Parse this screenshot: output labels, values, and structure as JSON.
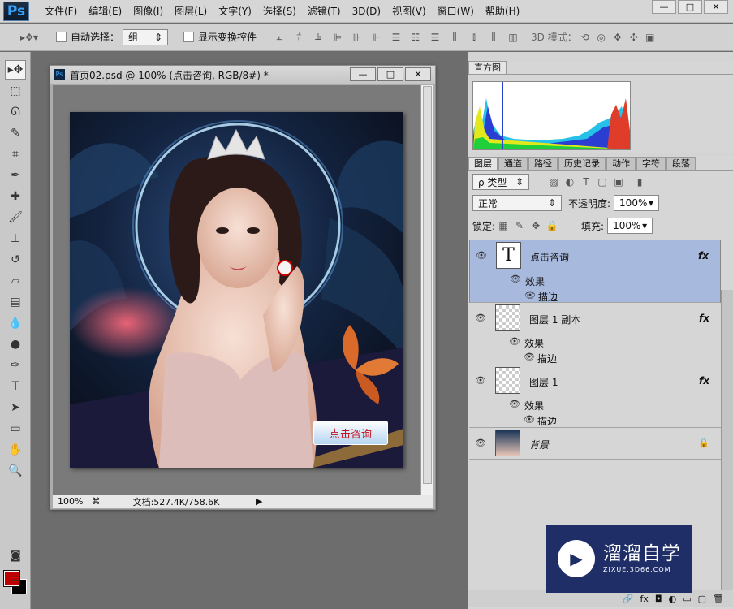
{
  "app": {
    "logo": "Ps",
    "menu": [
      "文件(F)",
      "编辑(E)",
      "图像(I)",
      "图层(L)",
      "文字(Y)",
      "选择(S)",
      "滤镜(T)",
      "3D(D)",
      "视图(V)",
      "窗口(W)",
      "帮助(H)"
    ],
    "window_buttons": [
      "—",
      "□",
      "✕"
    ]
  },
  "options": {
    "auto_select_label": "自动选择：",
    "auto_select_value": "组",
    "show_transform_label": "显示变换控件",
    "mode3d_label": "3D 模式："
  },
  "document": {
    "title": "首页02.psd @ 100% (点击咨询, RGB/8#) *",
    "zoom": "100%",
    "doc_info": "文档:527.4K/758.6K",
    "button_text": "点击咨询",
    "win_buttons": [
      "—",
      "□",
      "✕"
    ]
  },
  "histogram": {
    "tab": "直方图"
  },
  "layers_panel": {
    "tabs": [
      "图层",
      "通道",
      "路径",
      "历史记录",
      "动作",
      "字符",
      "段落"
    ],
    "filter_label": "ρ 类型",
    "blend_mode": "正常",
    "opacity_label": "不透明度:",
    "opacity_value": "100%",
    "lock_label": "锁定:",
    "fill_label": "填充:",
    "fill_value": "100%",
    "layers": [
      {
        "name": "点击咨询",
        "fx": "fx",
        "effects_label": "效果",
        "stroke_label": "描边"
      },
      {
        "name": "图层 1 副本",
        "fx": "fx",
        "effects_label": "效果",
        "stroke_label": "描边"
      },
      {
        "name": "图层 1",
        "fx": "fx",
        "effects_label": "效果",
        "stroke_label": "描边"
      },
      {
        "name": "背景"
      }
    ]
  },
  "watermark": {
    "title": "溜溜自学",
    "url": "ZIXUE.3D66.COM"
  }
}
